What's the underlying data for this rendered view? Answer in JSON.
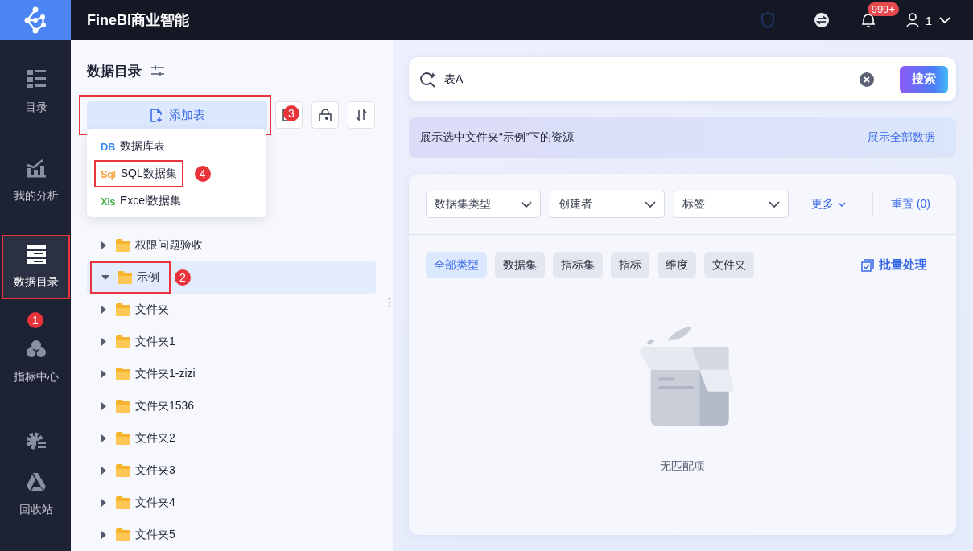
{
  "app": {
    "title": "FineBI商业智能"
  },
  "topbar": {
    "notification_count": "999+",
    "user_name": "1"
  },
  "sidebar": {
    "items": [
      {
        "label": "目录",
        "selected": false
      },
      {
        "label": "我的分析",
        "selected": false
      },
      {
        "label": "数据目录",
        "selected": true,
        "callout": "1"
      },
      {
        "label": "指标中心",
        "selected": false
      },
      {
        "selected": false
      },
      {
        "label": "回收站",
        "selected": false
      }
    ]
  },
  "catalog": {
    "title": "数据目录",
    "add_button": {
      "label": "添加表",
      "callout": "3"
    },
    "add_menu": [
      {
        "tag": "DB",
        "label": "数据库表",
        "color": "#3d8bf0"
      },
      {
        "tag": "Sql",
        "label": "SQL数据集",
        "color": "#f2a33a",
        "callout": "4"
      },
      {
        "tag": "Xls",
        "label": "Excel数据集",
        "color": "#45b04a"
      }
    ],
    "tree": [
      {
        "label": "权限问题验收",
        "expanded": false,
        "selected": false
      },
      {
        "label": "示例",
        "expanded": true,
        "selected": true,
        "callout": "2"
      },
      {
        "label": "文件夹",
        "expanded": false,
        "selected": false
      },
      {
        "label": "文件夹1",
        "expanded": false,
        "selected": false
      },
      {
        "label": "文件夹1-zizi",
        "expanded": false,
        "selected": false
      },
      {
        "label": "文件夹1536",
        "expanded": false,
        "selected": false
      },
      {
        "label": "文件夹2",
        "expanded": false,
        "selected": false
      },
      {
        "label": "文件夹3",
        "expanded": false,
        "selected": false
      },
      {
        "label": "文件夹4",
        "expanded": false,
        "selected": false
      },
      {
        "label": "文件夹5",
        "expanded": false,
        "selected": false
      }
    ]
  },
  "search": {
    "value": "表A",
    "button": "搜索"
  },
  "scope_notice": {
    "text": "展示选中文件夹“示例”下的资源",
    "link": "展示全部数据"
  },
  "filters": {
    "selects": [
      "数据集类型",
      "创建者",
      "标签"
    ],
    "more": "更多",
    "reset": "重置 (0)"
  },
  "type_chips": [
    {
      "label": "全部类型",
      "selected": true
    },
    {
      "label": "数据集",
      "selected": false
    },
    {
      "label": "指标集",
      "selected": false
    },
    {
      "label": "指标",
      "selected": false
    },
    {
      "label": "维度",
      "selected": false
    },
    {
      "label": "文件夹",
      "selected": false
    }
  ],
  "batch_button": "批量处理",
  "empty_state": {
    "text": "无匹配项"
  }
}
